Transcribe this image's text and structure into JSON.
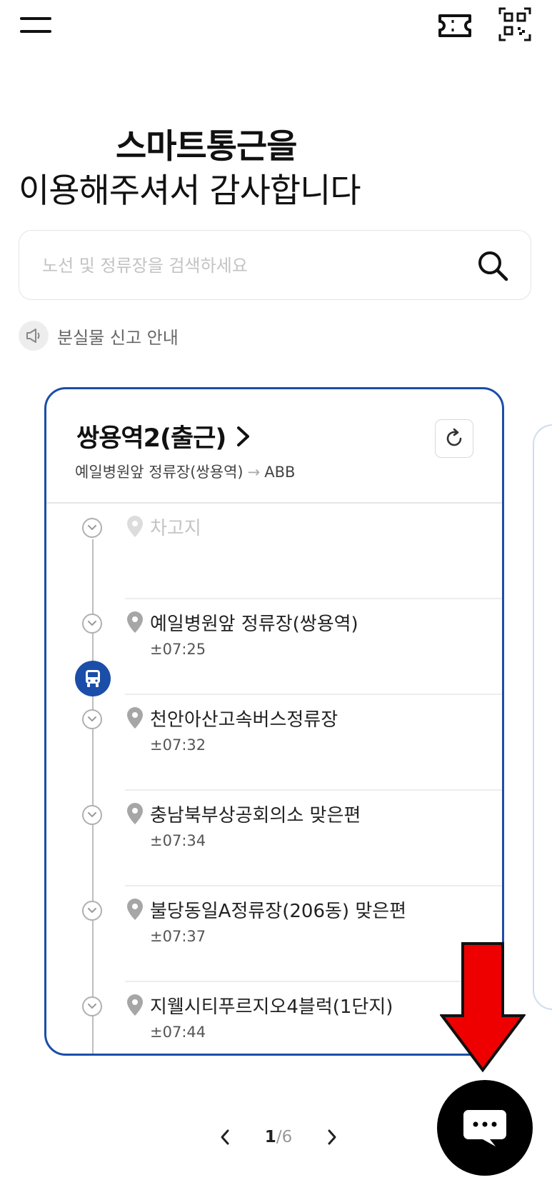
{
  "header": {
    "menu_icon": "hamburger-menu-icon",
    "ticket_icon": "ticket-icon",
    "qr_icon": "qr-code-icon"
  },
  "greeting": {
    "line1": "스마트통근을",
    "line2": "이용해주셔서 감사합니다"
  },
  "search": {
    "placeholder": "노선 및 정류장을 검색하세요",
    "value": ""
  },
  "lost_found": {
    "label": "분실물 신고 안내"
  },
  "route_card": {
    "route_name": "쌍용역2(출근)",
    "origin": "예일병원앞 정류장(쌍용역)",
    "arrow": "→",
    "destination": "ABB",
    "accent_color": "#1b4ea8",
    "stops": [
      {
        "name": "차고지",
        "time": "",
        "state": "garage"
      },
      {
        "name": "예일병원앞 정류장(쌍용역)",
        "time": "±07:25"
      },
      {
        "name": "천안아산고속버스정류장",
        "time": "±07:32"
      },
      {
        "name": "충남북부상공회의소 맞은편",
        "time": "±07:34"
      },
      {
        "name": "불당동일A정류장(206동) 맞은편",
        "time": "±07:37"
      },
      {
        "name": "지웰시티푸르지오4블럭(1단지)",
        "time": "±07:44"
      }
    ],
    "bus_position_between": [
      1,
      2
    ]
  },
  "pager": {
    "current": "1",
    "separator": "/",
    "total": "6"
  },
  "chat_fab_icon": "chat-bubble-icon",
  "annotation": {
    "type": "red-arrow-pointing-down",
    "color": "#ee0000"
  }
}
